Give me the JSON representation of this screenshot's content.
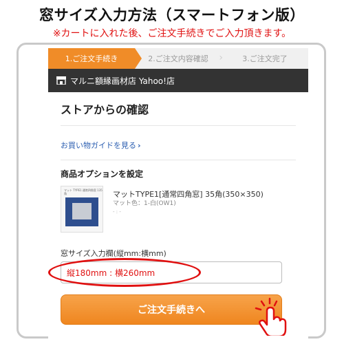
{
  "banner": {
    "title": "窓サイズ入力方法（スマートフォン版）",
    "subtitle": "※カートに入れた後、ご注文手続きでご入力頂きます。"
  },
  "steps": [
    {
      "label": "1.ご注文手続き",
      "active": true
    },
    {
      "label": "2.ご注文内容確認",
      "active": false
    },
    {
      "label": "3.ご注文完了",
      "active": false
    }
  ],
  "store": {
    "icon": "store-icon",
    "name": "マルニ額縁画材店 Yahoo!店"
  },
  "main": {
    "section_title": "ストアからの確認",
    "guide_link": "お買い物ガイドを見る",
    "option_title": "商品オプションを設定",
    "product": {
      "thumb_text": "マット TYPE1 通常四角窓 135角",
      "name": "マットTYPE1[通常四角窓] 35角(350×350)",
      "color": "マット色：1-白(OW1)",
      "extra": "- : -"
    },
    "window_size": {
      "label": "窓サイズ入力欄(縦mm:横mm)",
      "value": "縦180mm : 横260mm"
    },
    "order_button": "ご注文手続きへ"
  },
  "colors": {
    "accent": "#f08c28",
    "highlight": "#e01010",
    "store_bar": "#333333"
  }
}
